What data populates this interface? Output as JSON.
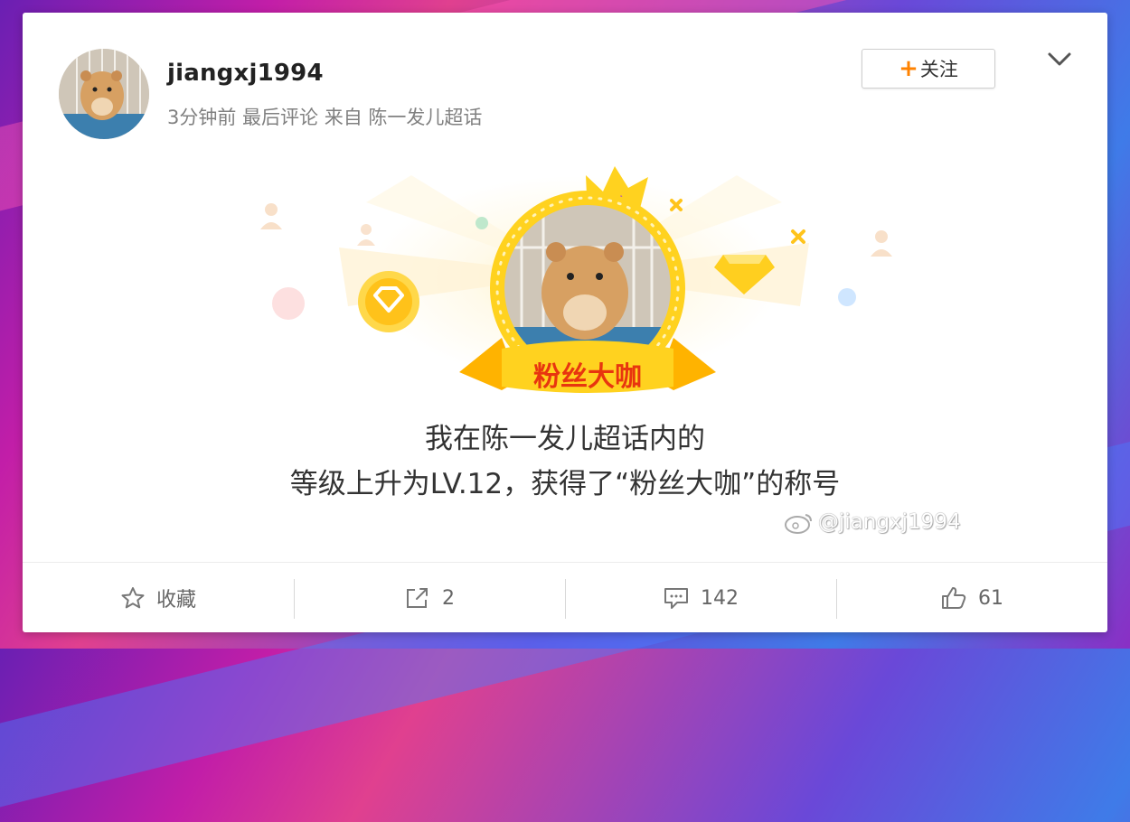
{
  "post": {
    "username": "jiangxj1994",
    "meta": "3分钟前 最后评论 来自 陈一发儿超话",
    "follow_label": "关注",
    "more_icon": "chevron-down-icon"
  },
  "badge": {
    "banner_text": "粉丝大咖",
    "line1": "我在陈一发儿超话内的",
    "line2": "等级上升为LV.12，获得了“粉丝大咖”的称号"
  },
  "watermark": "@jiangxj1994",
  "actions": [
    {
      "label": "收藏",
      "icon": "star-icon"
    },
    {
      "label": "2",
      "icon": "share-icon"
    },
    {
      "label": "142",
      "icon": "comment-icon"
    },
    {
      "label": "61",
      "icon": "thumbs-up-icon"
    }
  ],
  "colors": {
    "accent": "#ff8200",
    "gold": "#ffc400",
    "banner_text": "#e8350f"
  }
}
